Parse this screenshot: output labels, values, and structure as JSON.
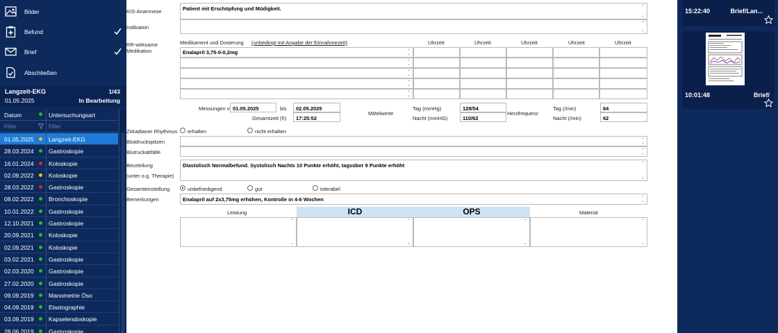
{
  "nav": [
    {
      "label": "Bilder",
      "done": false
    },
    {
      "label": "Befund",
      "done": true
    },
    {
      "label": "Brief",
      "done": true
    },
    {
      "label": "Abschließen",
      "done": false
    }
  ],
  "case": {
    "title": "Langzeit-EKG",
    "count": "1/43",
    "date": "01.05.2025",
    "status": "In Bearbeitung"
  },
  "list_header": {
    "date": "Datum",
    "type": "Untersuchungsart"
  },
  "filter": {
    "date": "Filter",
    "type": "Filter"
  },
  "exams": [
    {
      "date": "01.05.2025",
      "type": "Langzeit-EKG",
      "status": "yellow",
      "selected": true
    },
    {
      "date": "28.03.2024",
      "type": "Gastroskopie",
      "status": "green"
    },
    {
      "date": "16.01.2024",
      "type": "Koloskopie",
      "status": "red"
    },
    {
      "date": "02.09.2022",
      "type": "Koloskopie",
      "status": "yellow"
    },
    {
      "date": "28.03.2022",
      "type": "Gastroskopie",
      "status": "red"
    },
    {
      "date": "08.02.2022",
      "type": "Bronchoskopie",
      "status": "green"
    },
    {
      "date": "10.01.2022",
      "type": "Gastroskopie",
      "status": "green"
    },
    {
      "date": "12.10.2021",
      "type": "Gastroskopie",
      "status": "green"
    },
    {
      "date": "20.09.2021",
      "type": "Koloskopie",
      "status": "green"
    },
    {
      "date": "02.09.2021",
      "type": "Koloskopie",
      "status": "green"
    },
    {
      "date": "03.02.2021",
      "type": "Gastroskopie",
      "status": "green"
    },
    {
      "date": "02.03.2020",
      "type": "Gastroskopie",
      "status": "green"
    },
    {
      "date": "27.02.2020",
      "type": "Gastroskopie",
      "status": "green"
    },
    {
      "date": "09.09.2019",
      "type": "Manometrie Öso",
      "status": "green"
    },
    {
      "date": "04.09.2019",
      "type": "Elastographie",
      "status": "green"
    },
    {
      "date": "03.09.2019",
      "type": "Kapselendoskopie",
      "status": "green"
    },
    {
      "date": "28.06.2019",
      "type": "Gastroskopie",
      "status": "green"
    }
  ],
  "form": {
    "kis_label": "KIS-Anamnese",
    "kis_value": "Patient mit Erschöpfung und Müdigkeit.",
    "indikation_label": "Indikation",
    "indikation_value": "",
    "rr_label": "RR-wirksame Medikation",
    "med_header": "Medikament und Dosierung",
    "med_hint": "(unbedingt mit Angabe der Einnahmezeit)",
    "uhrzeit": "Uhrzeit",
    "med_rows": [
      "Enalapril 3,75-0-0,2mg",
      "",
      "",
      "",
      ""
    ],
    "messungen_label": "Messungen vom",
    "messungen_von": "01.05.2025",
    "bis_label": "bis",
    "messungen_bis": "02.05.2025",
    "gesamtzeit_label": "Gesamtzeit (h)",
    "gesamtzeit": "17:25:52",
    "mittelwerte_label": "Mittelwerte",
    "tag_mmhg_label": "Tag (mmHg)",
    "tag_mmhg": "128/54",
    "nacht_mmhg_label": "Nacht (mmHG)",
    "nacht_mmhg": "110/62",
    "herzfrequenz_label": "Herzfrequenz",
    "tag_min_label": "Tag (/min)",
    "tag_min": "64",
    "nacht_min_label": "Nacht (/min)",
    "nacht_min": "62",
    "zirkadian_label": "Zirkadianer Rhythmus",
    "zirkadian_opt1": "erhalten",
    "zirkadian_opt2": "nicht erhalten",
    "spitzen_label": "Blutdruckspitzen",
    "abfaelle_label": "Blutruckabfälle",
    "beurteilung_label": "Beurteilung",
    "beurteilung_sub": "(unter o.g. Therapie)",
    "beurteilung_value": "Diastolisch Normalbefund. Systolisch Nachts 10 Punkte erhöht, tagsüber 9 Punkte erhöht",
    "gesamt_label": "Gesamteinstellung",
    "gesamt_opt1": "unbefriedigend",
    "gesamt_opt2": "gut",
    "gesamt_opt3": "tolerabel",
    "bemerkungen_label": "Bemerkungen",
    "bemerkungen_value": "Enalapril auf 2x3,75mg erhöhen, Kontrolle in 4-6 Wochen",
    "leistung_label": "Leistung",
    "icd_label": "ICD",
    "ops_label": "OPS",
    "material_label": "Material"
  },
  "right": {
    "cards": [
      {
        "time": "15:22:40",
        "type": "Brief/Lan..."
      },
      {
        "time": "10:01:48",
        "type": "Brief/"
      }
    ]
  },
  "colors": {
    "navy": "#0e2a5c",
    "selected": "#1e7cd6",
    "green": "#1fc11f",
    "yellow": "#e8c21a",
    "red": "#e0262c",
    "icd_header": "#cde4f6"
  }
}
